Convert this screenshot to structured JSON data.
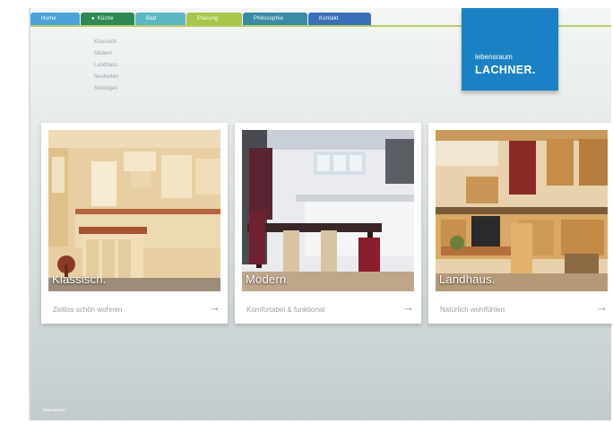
{
  "nav": {
    "tabs": [
      {
        "label": "Home",
        "color": "#4aa2d9"
      },
      {
        "label": "Küche",
        "color": "#2d8a52",
        "active": true
      },
      {
        "label": "Bad",
        "color": "#5cb8c4"
      },
      {
        "label": "Planung",
        "color": "#a9c54a"
      },
      {
        "label": "Philosophie",
        "color": "#3a8ba4"
      },
      {
        "label": "Kontakt",
        "color": "#3a6fb8"
      }
    ]
  },
  "logo": {
    "line1": "lebensraum",
    "line2": "LACHNER.",
    "color": "#1a82c4"
  },
  "subnav": {
    "items": [
      "Klassisch",
      "Modern",
      "Landhaus",
      "Neubeiten",
      "Sonstiges"
    ]
  },
  "cards": [
    {
      "caption": "Klassisch.",
      "subtitle": "Zeitlos schön wohnen",
      "arrow": "→"
    },
    {
      "caption": "Modern.",
      "subtitle": "Komfortabel & funktional",
      "arrow": "→"
    },
    {
      "caption": "Landhaus.",
      "subtitle": "Natürlich wohlfühlen",
      "arrow": "→"
    }
  ],
  "footer": {
    "text": "Impressum"
  }
}
